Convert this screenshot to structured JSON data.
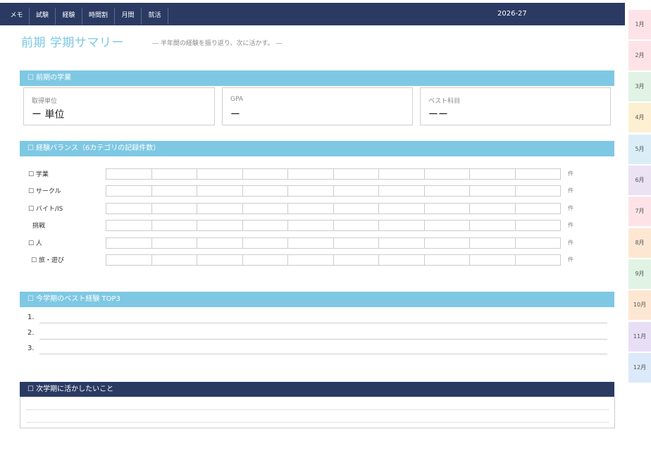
{
  "nav": {
    "items": [
      "メモ",
      "試験",
      "経験",
      "時間割",
      "月間",
      "就活"
    ],
    "year": "2026-27"
  },
  "months": {
    "items": [
      "1月",
      "2月",
      "3月",
      "4月",
      "5月",
      "6月",
      "7月",
      "8月",
      "9月",
      "10月",
      "11月",
      "12月"
    ],
    "colors": [
      "#fde3e8",
      "#fde3e8",
      "#e0f3e4",
      "#fdf0d2",
      "#dbeef7",
      "#ebe2f4",
      "#fde3e8",
      "#fde7d2",
      "#e0f3e4",
      "#fde7d2",
      "#e8dff7",
      "#dbe9fb"
    ]
  },
  "page": {
    "title": "前期 学期サマリー",
    "subtitle": "― 半年間の経験を振り返り、次に活かす。 ―"
  },
  "academics": {
    "heading": "☐ 前期の学業",
    "stats": [
      {
        "label": "取得単位",
        "value": "ー 単位"
      },
      {
        "label": "GPA",
        "value": "ー"
      },
      {
        "label": "ベスト科目",
        "value": "ーー"
      }
    ]
  },
  "balance": {
    "heading": "☐ 経験バランス（6カテゴリの記録件数）",
    "rows": [
      {
        "label": "☐ 学業",
        "unit": "件",
        "count": 0
      },
      {
        "label": "☐ サークル",
        "unit": "件",
        "count": 0
      },
      {
        "label": "☐ バイト/IS",
        "unit": "件",
        "count": 0
      },
      {
        "label": "挑戦",
        "unit": "件",
        "count": 0
      },
      {
        "label": "☐ 人",
        "unit": "件",
        "count": 0
      },
      {
        "label": "☐ 旅・遊び",
        "unit": "件",
        "count": 0
      }
    ]
  },
  "top3": {
    "heading": "☐ 今学期のベスト経験 TOP3",
    "items": [
      "1.",
      "2.",
      "3."
    ]
  },
  "next": {
    "heading": "☐ 次学期に活かしたいこと"
  },
  "colors": {
    "navy": "#2a3a63",
    "accent": "#7ec8e3",
    "title": "#7cc8e4"
  }
}
